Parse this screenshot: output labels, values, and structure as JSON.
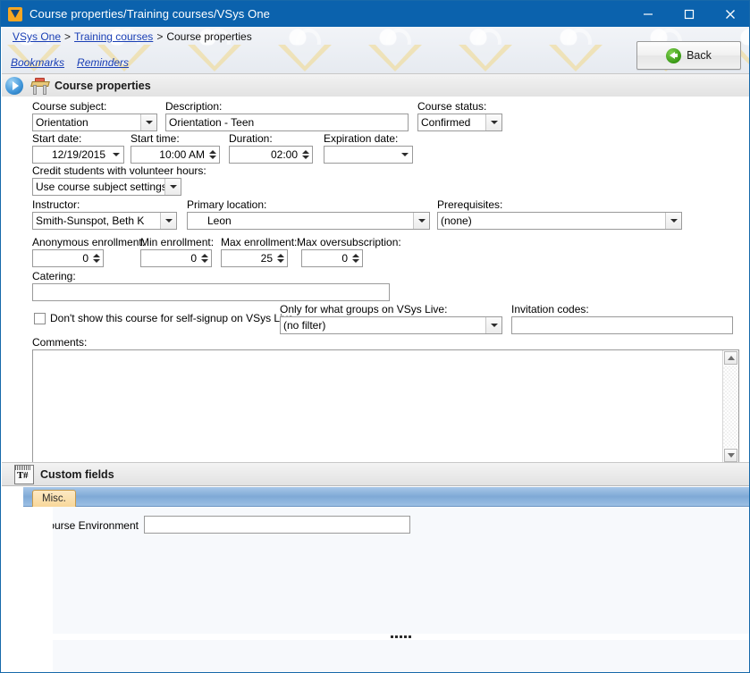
{
  "window": {
    "title": "Course properties/Training courses/VSys One",
    "icon": "vsys-logo-icon",
    "minimize": "minimize-icon",
    "maximize": "maximize-icon",
    "close": "close-icon"
  },
  "breadcrumb": {
    "items": [
      {
        "label": "VSys One",
        "link": true
      },
      {
        "label": ">",
        "link": false
      },
      {
        "label": "Training courses",
        "link": true
      },
      {
        "label": ">",
        "link": false
      },
      {
        "label": "Course properties",
        "link": false
      }
    ]
  },
  "quicklinks": [
    {
      "label": "Bookmarks"
    },
    {
      "label": "Reminders"
    }
  ],
  "back_button": {
    "label": "Back",
    "icon": "back-arrow-icon"
  },
  "sections": {
    "course_properties": {
      "title": "Course properties",
      "icon": "school-desk-icon",
      "expander": "expand-collapse-icon"
    },
    "custom_fields": {
      "title": "Custom fields",
      "icon": "custom-fields-icon"
    }
  },
  "form": {
    "course_subject": {
      "label": "Course subject:",
      "value": "Orientation"
    },
    "description": {
      "label": "Description:",
      "value": "Orientation - Teen"
    },
    "course_status": {
      "label": "Course status:",
      "value": "Confirmed"
    },
    "start_date": {
      "label": "Start date:",
      "value": "12/19/2015"
    },
    "start_time": {
      "label": "Start time:",
      "value": "10:00 AM"
    },
    "duration": {
      "label": "Duration:",
      "value": "02:00"
    },
    "expiration_date": {
      "label": "Expiration date:",
      "value": ""
    },
    "credit_students": {
      "label": "Credit students with volunteer hours:",
      "value": "Use course subject settings"
    },
    "instructor": {
      "label": "Instructor:",
      "value": "Smith-Sunspot, Beth K"
    },
    "primary_location": {
      "label": "Primary location:",
      "value": "Leon"
    },
    "prerequisites": {
      "label": "Prerequisites:",
      "value": "(none)"
    },
    "anonymous_enrollment": {
      "label": "Anonymous enrollment:",
      "value": "0"
    },
    "min_enrollment": {
      "label": "Min enrollment:",
      "value": "0"
    },
    "max_enrollment": {
      "label": "Max enrollment:",
      "value": "25"
    },
    "max_oversubscription": {
      "label": "Max oversubscription:",
      "value": "0"
    },
    "catering": {
      "label": "Catering:",
      "value": ""
    },
    "hide_self_signup": {
      "label": "Don't show this course for self-signup on VSys Live",
      "checked": false
    },
    "groups_filter": {
      "label": "Only for what groups on VSys Live:",
      "value": "(no filter)"
    },
    "invitation_codes": {
      "label": "Invitation codes:",
      "value": ""
    },
    "comments": {
      "label": "Comments:",
      "value": ""
    }
  },
  "custom_fields": {
    "tabs": [
      {
        "label": "Misc.",
        "active": true
      }
    ],
    "fields": [
      {
        "label": "Course Environment",
        "value": ""
      }
    ]
  },
  "colors": {
    "titlebar": "#0b62ad",
    "accent_link": "#1a3fb5",
    "tab_active": "#f8d79a",
    "tabstrip": "#7fa9d6",
    "back_icon_green": "#3a9a17"
  }
}
